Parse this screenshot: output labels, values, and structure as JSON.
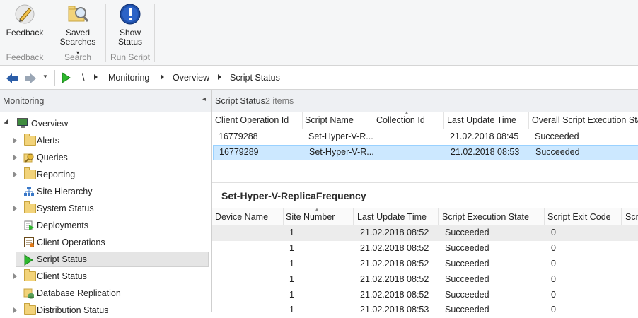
{
  "ribbon": {
    "buttons": [
      {
        "label": "Feedback",
        "icon": "feedback-pen-icon"
      },
      {
        "label": "Saved\nSearches ▾",
        "line1": "Saved",
        "line2": "Searches",
        "icon": "saved-searches-icon"
      },
      {
        "label": "Show Status",
        "line1": "Show",
        "line2": "Status",
        "icon": "info-icon"
      }
    ],
    "groups": [
      "Feedback",
      "Search",
      "Run Script"
    ]
  },
  "address": {
    "root": "\\",
    "crumbs": [
      "Monitoring",
      "Overview",
      "Script Status"
    ]
  },
  "nav": {
    "title": "Monitoring",
    "items": [
      {
        "label": "Overview",
        "icon": "console-icon"
      },
      {
        "label": "Alerts",
        "icon": "folder-icon"
      },
      {
        "label": "Queries",
        "icon": "queries-icon"
      },
      {
        "label": "Reporting",
        "icon": "folder-icon"
      },
      {
        "label": "Site Hierarchy",
        "icon": "site-hierarchy-icon"
      },
      {
        "label": "System Status",
        "icon": "folder-icon"
      },
      {
        "label": "Deployments",
        "icon": "deployments-icon"
      },
      {
        "label": "Client Operations",
        "icon": "client-operations-icon"
      },
      {
        "label": "Script Status",
        "icon": "play-icon"
      },
      {
        "label": "Client Status",
        "icon": "folder-icon"
      },
      {
        "label": "Database Replication",
        "icon": "database-replication-icon"
      },
      {
        "label": "Distribution Status",
        "icon": "folder-icon"
      }
    ]
  },
  "list": {
    "title": "Script Status",
    "count": "2 items",
    "columns": [
      "Client Operation Id",
      "Script Name",
      "Collection Id",
      "Last Update Time",
      "Overall Script Execution Stat"
    ],
    "rows": [
      [
        "16779288",
        "Set-Hyper-V-R...",
        "",
        "21.02.2018 08:45",
        "Succeeded"
      ],
      [
        "16779289",
        "Set-Hyper-V-R...",
        "",
        "21.02.2018 08:53",
        "Succeeded"
      ]
    ]
  },
  "details": {
    "title": "Set-Hyper-V-ReplicaFrequency",
    "columns": [
      "Device Name",
      "Site Number",
      "Last Update Time",
      "Script Execution State",
      "Script Exit Code",
      "Scr"
    ],
    "rows": [
      [
        "",
        "1",
        "21.02.2018 08:52",
        "Succeeded",
        "0"
      ],
      [
        "",
        "1",
        "21.02.2018 08:52",
        "Succeeded",
        "0"
      ],
      [
        "",
        "1",
        "21.02.2018 08:52",
        "Succeeded",
        "0"
      ],
      [
        "",
        "1",
        "21.02.2018 08:52",
        "Succeeded",
        "0"
      ],
      [
        "",
        "1",
        "21.02.2018 08:52",
        "Succeeded",
        "0"
      ],
      [
        "",
        "1",
        "21.02.2018 08:53",
        "Succeeded",
        "0"
      ]
    ]
  },
  "colors": {
    "selected_row": "#cce8ff",
    "selected_border": "#99d1ff",
    "nav_selected": "#e5e5e5",
    "play_green": "#2db82d"
  }
}
